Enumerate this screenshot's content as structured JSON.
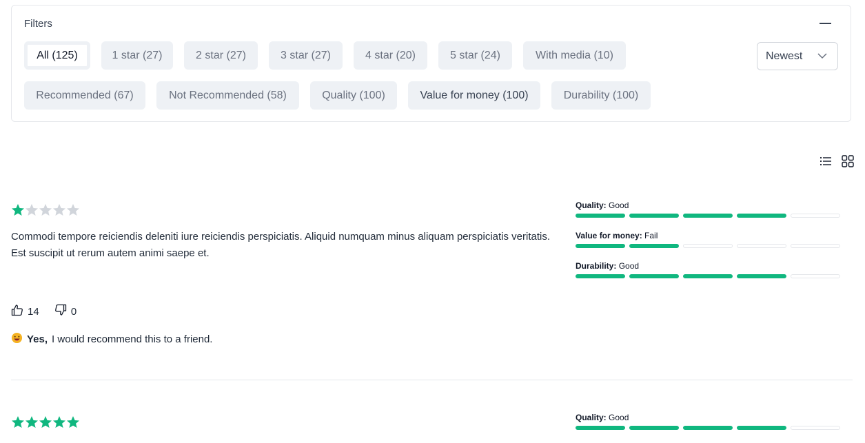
{
  "filters": {
    "title": "Filters",
    "chips_row1": [
      {
        "label": "All (125)",
        "active": true
      },
      {
        "label": "1 star (27)"
      },
      {
        "label": "2 star (27)"
      },
      {
        "label": "3 star (27)"
      },
      {
        "label": "4 star (20)"
      },
      {
        "label": "5 star (24)"
      },
      {
        "label": "With media (10)"
      }
    ],
    "chips_row2": [
      {
        "label": "Recommended (67)"
      },
      {
        "label": "Not Recommended (58)"
      },
      {
        "label": "Quality (100)"
      },
      {
        "label": "Value for money (100)"
      },
      {
        "label": "Durability (100)"
      }
    ],
    "sort": {
      "selected": "Newest"
    }
  },
  "colors": {
    "accent": "#10b77f",
    "chip_bg": "#eef1f5",
    "star_empty": "#d1d5db"
  },
  "reviews": [
    {
      "stars": 1,
      "text": "Commodi tempore reiciendis deleniti iure reiciendis perspiciatis. Aliquid numquam minus aliquam perspiciatis veritatis. Est suscipit ut rerum autem animi saepe et.",
      "helpful": "14",
      "not_helpful": "0",
      "recommend_yes": "Yes,",
      "recommend_text": "I would recommend this to a friend.",
      "ratings": [
        {
          "label": "Quality:",
          "value": "Good",
          "level": 4,
          "max": 5
        },
        {
          "label": "Value for money:",
          "value": "Fail",
          "level": 2,
          "max": 5
        },
        {
          "label": "Durability:",
          "value": "Good",
          "level": 4,
          "max": 5
        }
      ]
    },
    {
      "stars": 5,
      "ratings": [
        {
          "label": "Quality:",
          "value": "Good",
          "level": 4,
          "max": 5
        }
      ]
    }
  ]
}
